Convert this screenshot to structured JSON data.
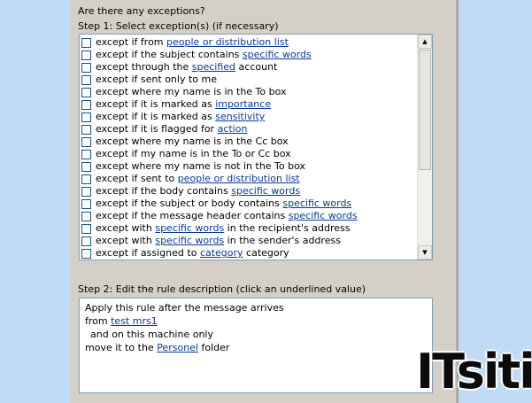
{
  "dialog": {
    "question": "Are there any exceptions?",
    "step1_label": "Step 1: Select exception(s) (if necessary)",
    "step2_label": "Step 2: Edit the rule description (click an underlined value)"
  },
  "exceptions": [
    {
      "pre": "except if from ",
      "link": "people or distribution list",
      "post": ""
    },
    {
      "pre": "except if the subject contains ",
      "link": "specific words",
      "post": ""
    },
    {
      "pre": "except through the ",
      "link": "specified",
      "post": " account"
    },
    {
      "pre": "except if sent only to me",
      "link": "",
      "post": ""
    },
    {
      "pre": "except where my name is in the To box",
      "link": "",
      "post": ""
    },
    {
      "pre": "except if it is marked as ",
      "link": "importance",
      "post": ""
    },
    {
      "pre": "except if it is marked as ",
      "link": "sensitivity",
      "post": ""
    },
    {
      "pre": "except if it is flagged for ",
      "link": "action",
      "post": ""
    },
    {
      "pre": "except where my name is in the Cc box",
      "link": "",
      "post": ""
    },
    {
      "pre": "except if my name is in the To or Cc box",
      "link": "",
      "post": ""
    },
    {
      "pre": "except where my name is not in the To box",
      "link": "",
      "post": ""
    },
    {
      "pre": "except if sent to ",
      "link": "people or distribution list",
      "post": ""
    },
    {
      "pre": "except if the body contains ",
      "link": "specific words",
      "post": ""
    },
    {
      "pre": "except if the subject or body contains ",
      "link": "specific words",
      "post": ""
    },
    {
      "pre": "except if the message header contains ",
      "link": "specific words",
      "post": ""
    },
    {
      "pre": "except with ",
      "link": "specific words",
      "post": " in the recipient's address"
    },
    {
      "pre": "except with ",
      "link": "specific words",
      "post": " in the sender's address"
    },
    {
      "pre": "except if assigned to ",
      "link": "category",
      "post": " category"
    }
  ],
  "description": {
    "line1": "Apply this rule after the message arrives",
    "line2_pre": "from ",
    "line2_link": "test mrs1",
    "line3": "and on this machine only",
    "line4_pre": "move it to the ",
    "line4_link": "Personel",
    "line4_post": " folder"
  },
  "scrollbar": {
    "up_icon": "▲",
    "down_icon": "▼"
  },
  "watermark": {
    "text": "ITsiti"
  }
}
